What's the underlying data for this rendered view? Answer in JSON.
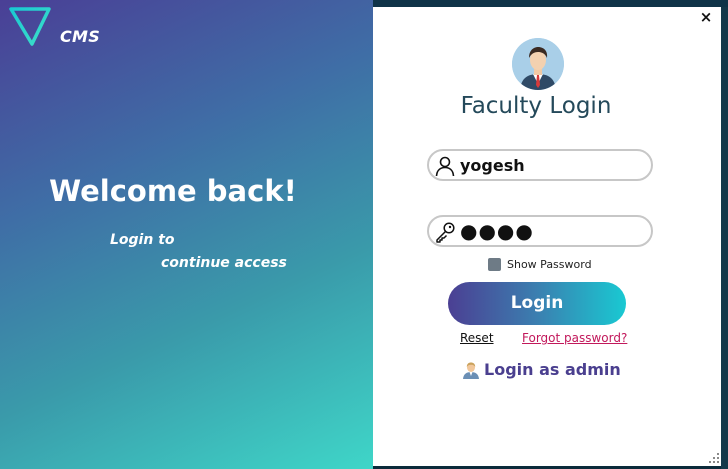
{
  "brand": {
    "name": "CMS"
  },
  "welcome": {
    "heading": "Welcome back!",
    "subtitle_line1": "Login to",
    "subtitle_line2": "continue access"
  },
  "window": {
    "close_label": "×"
  },
  "login": {
    "title": "Faculty Login",
    "username_value": "yogesh",
    "password_mask": "●●●●",
    "show_password_label": "Show Password",
    "show_password_checked": false,
    "login_button": "Login",
    "reset_link": "Reset",
    "forgot_link": "Forgot password?",
    "admin_link": "Login as admin"
  },
  "icons": {
    "logo": "triangle-logo-icon",
    "avatar": "faculty-avatar-icon",
    "user": "user-icon",
    "password": "key-icon",
    "admin": "admin-icon",
    "close": "close-icon"
  },
  "colors": {
    "gradient_start": "#4a3f96",
    "gradient_end": "#3fd6c8",
    "title": "#24495a",
    "forgot_link": "#c2185b",
    "admin_link": "#4a3f8f"
  }
}
